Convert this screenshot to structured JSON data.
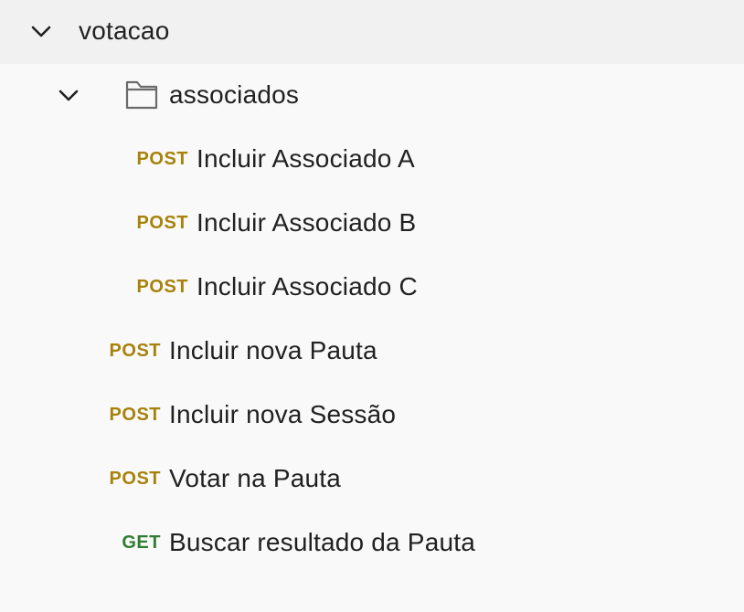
{
  "collection": {
    "name": "votacao",
    "expanded": true,
    "folder": {
      "name": "associados",
      "expanded": true,
      "icon": "folder-icon",
      "requests": [
        {
          "method": "POST",
          "name": "Incluir Associado A"
        },
        {
          "method": "POST",
          "name": "Incluir Associado B"
        },
        {
          "method": "POST",
          "name": "Incluir Associado C"
        }
      ]
    },
    "requests": [
      {
        "method": "POST",
        "name": "Incluir nova Pauta"
      },
      {
        "method": "POST",
        "name": "Incluir nova Sessão"
      },
      {
        "method": "POST",
        "name": "Votar na Pauta"
      },
      {
        "method": "GET",
        "name": "Buscar resultado da Pauta"
      }
    ]
  },
  "colors": {
    "post": "#a7820b",
    "get": "#2f7d32",
    "text": "#212121",
    "background": "#f9f9f9"
  }
}
